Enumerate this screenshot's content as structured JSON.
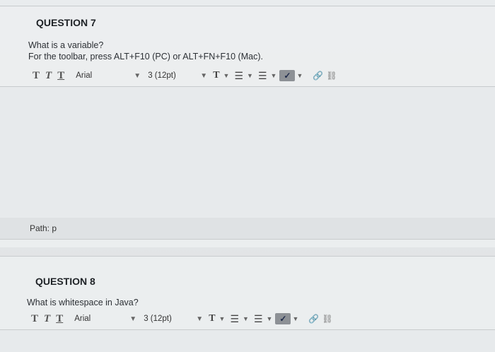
{
  "q7": {
    "title": "QUESTION 7",
    "question": "What is a variable?",
    "instructions": "For the toolbar, press ALT+F10 (PC) or ALT+FN+F10 (Mac).",
    "font_family": "Arial",
    "font_size": "3 (12pt)",
    "path_label": "Path: p"
  },
  "q8": {
    "title": "QUESTION 8",
    "question": "What is whitespace in Java?",
    "font_family": "Arial",
    "font_size": "3 (12pt)"
  },
  "toolbar_icons": [
    "bold-t",
    "italic-t",
    "underline-t",
    "text-color",
    "bullet-list",
    "numbered-list",
    "spellcheck",
    "link",
    "unlink"
  ]
}
